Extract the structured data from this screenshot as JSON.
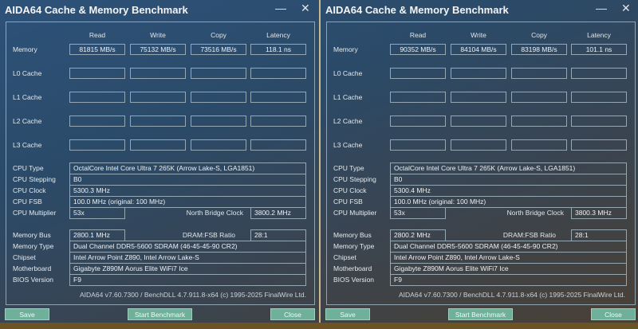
{
  "panels": [
    {
      "title": "AIDA64 Cache & Memory Benchmark",
      "window_controls": {
        "minimize": "—",
        "close": "✕"
      },
      "columns": {
        "read": "Read",
        "write": "Write",
        "copy": "Copy",
        "latency": "Latency"
      },
      "rows": {
        "memory": "Memory",
        "l0": "L0 Cache",
        "l1": "L1 Cache",
        "l2": "L2 Cache",
        "l3": "L3 Cache"
      },
      "memory": {
        "read": "81815 MB/s",
        "write": "75132 MB/s",
        "copy": "73516 MB/s",
        "latency": "118.1 ns"
      },
      "info_labels": {
        "cpu_type": "CPU Type",
        "cpu_stepping": "CPU Stepping",
        "cpu_clock": "CPU Clock",
        "cpu_fsb": "CPU FSB",
        "cpu_multiplier": "CPU Multiplier",
        "nb_clock": "North Bridge Clock",
        "memory_bus": "Memory Bus",
        "dram_fsb": "DRAM:FSB Ratio",
        "memory_type": "Memory Type",
        "chipset": "Chipset",
        "motherboard": "Motherboard",
        "bios": "BIOS Version"
      },
      "info": {
        "cpu_type": "OctalCore Intel Core Ultra 7 265K  (Arrow Lake-S, LGA1851)",
        "cpu_stepping": "B0",
        "cpu_clock": "5300.3 MHz",
        "cpu_fsb": "100.0 MHz  (original: 100 MHz)",
        "cpu_multiplier": "53x",
        "nb_clock": "3800.2 MHz",
        "memory_bus": "2800.1 MHz",
        "dram_fsb": "28:1",
        "memory_type": "Dual Channel DDR5-5600 SDRAM  (46-45-45-90 CR2)",
        "chipset": "Intel Arrow Point Z890, Intel Arrow Lake-S",
        "motherboard": "Gigabyte Z890M Aorus Elite WiFi7 Ice",
        "bios": "F9"
      },
      "footer": "AIDA64 v7.60.7300 / BenchDLL 4.7.911.8-x64  (c) 1995-2025 FinalWire Ltd.",
      "buttons": {
        "save": "Save",
        "start": "Start Benchmark",
        "close": "Close"
      }
    },
    {
      "title": "AIDA64 Cache & Memory Benchmark",
      "window_controls": {
        "minimize": "—",
        "close": "✕"
      },
      "columns": {
        "read": "Read",
        "write": "Write",
        "copy": "Copy",
        "latency": "Latency"
      },
      "rows": {
        "memory": "Memory",
        "l0": "L0 Cache",
        "l1": "L1 Cache",
        "l2": "L2 Cache",
        "l3": "L3 Cache"
      },
      "memory": {
        "read": "90352 MB/s",
        "write": "84104 MB/s",
        "copy": "83198 MB/s",
        "latency": "101.1 ns"
      },
      "info_labels": {
        "cpu_type": "CPU Type",
        "cpu_stepping": "CPU Stepping",
        "cpu_clock": "CPU Clock",
        "cpu_fsb": "CPU FSB",
        "cpu_multiplier": "CPU Multiplier",
        "nb_clock": "North Bridge Clock",
        "memory_bus": "Memory Bus",
        "dram_fsb": "DRAM:FSB Ratio",
        "memory_type": "Memory Type",
        "chipset": "Chipset",
        "motherboard": "Motherboard",
        "bios": "BIOS Version"
      },
      "info": {
        "cpu_type": "OctalCore Intel Core Ultra 7 265K  (Arrow Lake-S, LGA1851)",
        "cpu_stepping": "B0",
        "cpu_clock": "5300.4 MHz",
        "cpu_fsb": "100.0 MHz  (original: 100 MHz)",
        "cpu_multiplier": "53x",
        "nb_clock": "3800.3 MHz",
        "memory_bus": "2800.2 MHz",
        "dram_fsb": "28:1",
        "memory_type": "Dual Channel DDR5-5600 SDRAM  (46-45-45-90 CR2)",
        "chipset": "Intel Arrow Point Z890, Intel Arrow Lake-S",
        "motherboard": "Gigabyte Z890M Aorus Elite WiFi7 Ice",
        "bios": "F9"
      },
      "footer": "AIDA64 v7.60.7300 / BenchDLL 4.7.911.8-x64  (c) 1995-2025 FinalWire Ltd.",
      "buttons": {
        "save": "Save",
        "start": "Start Benchmark",
        "close": "Close"
      }
    }
  ]
}
